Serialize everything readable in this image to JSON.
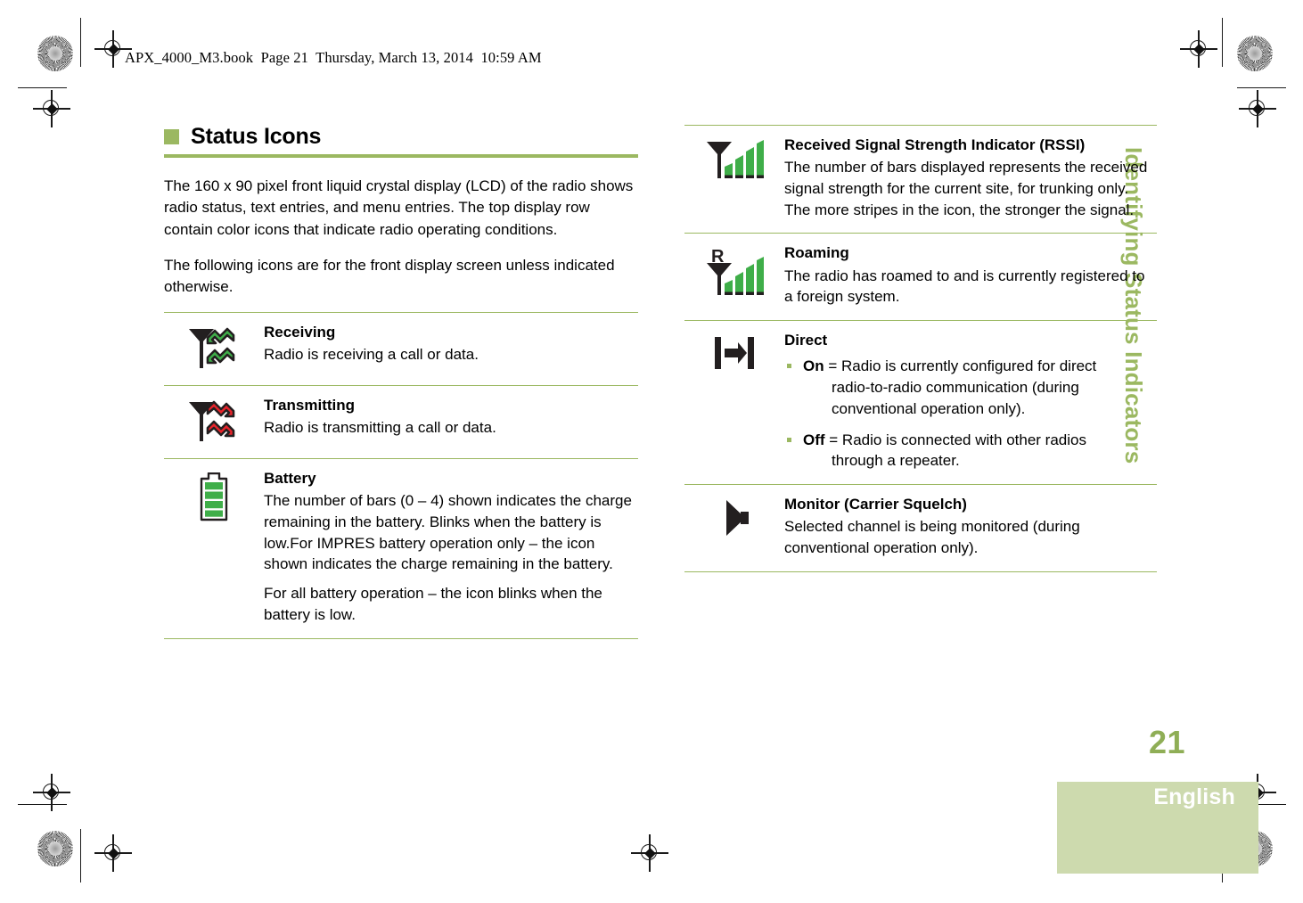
{
  "header": {
    "file_info": "APX_4000_M3.book  Page 21  Thursday, March 13, 2014  10:59 AM"
  },
  "sidebar": {
    "running_head": "Identifying Status Indicators"
  },
  "footer": {
    "page_number": "21",
    "language": "English"
  },
  "colors": {
    "accent_green": "#9bb861",
    "block_green": "#cddaae",
    "page_number_green": "#8fae56",
    "icon_green": "#3fae49",
    "icon_red": "#e8232a",
    "icon_black": "#231f20"
  },
  "left_column": {
    "section": {
      "title": "Status Icons",
      "paragraphs": [
        "The 160 x 90 pixel front liquid crystal display (LCD) of the radio shows radio status, text entries, and menu entries. The top display row contain color icons that indicate radio operating conditions.",
        "The following icons are for the front display screen unless indicated otherwise."
      ]
    },
    "rows": [
      {
        "icon": "antenna-receiving-icon",
        "title": "Receiving",
        "texts": [
          "Radio is receiving a call or data."
        ]
      },
      {
        "icon": "antenna-transmitting-icon",
        "title": "Transmitting",
        "texts": [
          "Radio is transmitting a call or data."
        ]
      },
      {
        "icon": "battery-icon",
        "title": "Battery",
        "texts": [
          "The number of bars (0 – 4) shown indicates the charge remaining in the battery. Blinks when the battery is low.For IMPRES battery operation only – the icon shown indicates the charge remaining in the battery.",
          "For all battery operation – the icon blinks when the battery is low."
        ]
      }
    ]
  },
  "right_column": {
    "rows": [
      {
        "icon": "signal-strength-icon",
        "title": "Received Signal Strength Indicator (RSSI)",
        "texts": [
          "The number of bars displayed represents the received signal strength for the current site, for trunking only. The more stripes in the icon, the stronger the signal."
        ]
      },
      {
        "icon": "roaming-icon",
        "title": "Roaming",
        "texts": [
          "The radio has roamed to and is currently registered to a foreign system."
        ]
      },
      {
        "icon": "direct-icon",
        "title": "Direct",
        "bullets": [
          {
            "label": "On",
            "lead": " = Radio is currently configured for direct",
            "rest": "radio-to-radio communication (during conventional operation only)."
          },
          {
            "label": "Off",
            "lead": " = Radio is connected with other radios",
            "rest": "through a repeater."
          }
        ]
      },
      {
        "icon": "monitor-speaker-icon",
        "title": "Monitor (Carrier Squelch)",
        "texts": [
          "Selected channel is being monitored (during conventional operation only)."
        ]
      }
    ]
  }
}
